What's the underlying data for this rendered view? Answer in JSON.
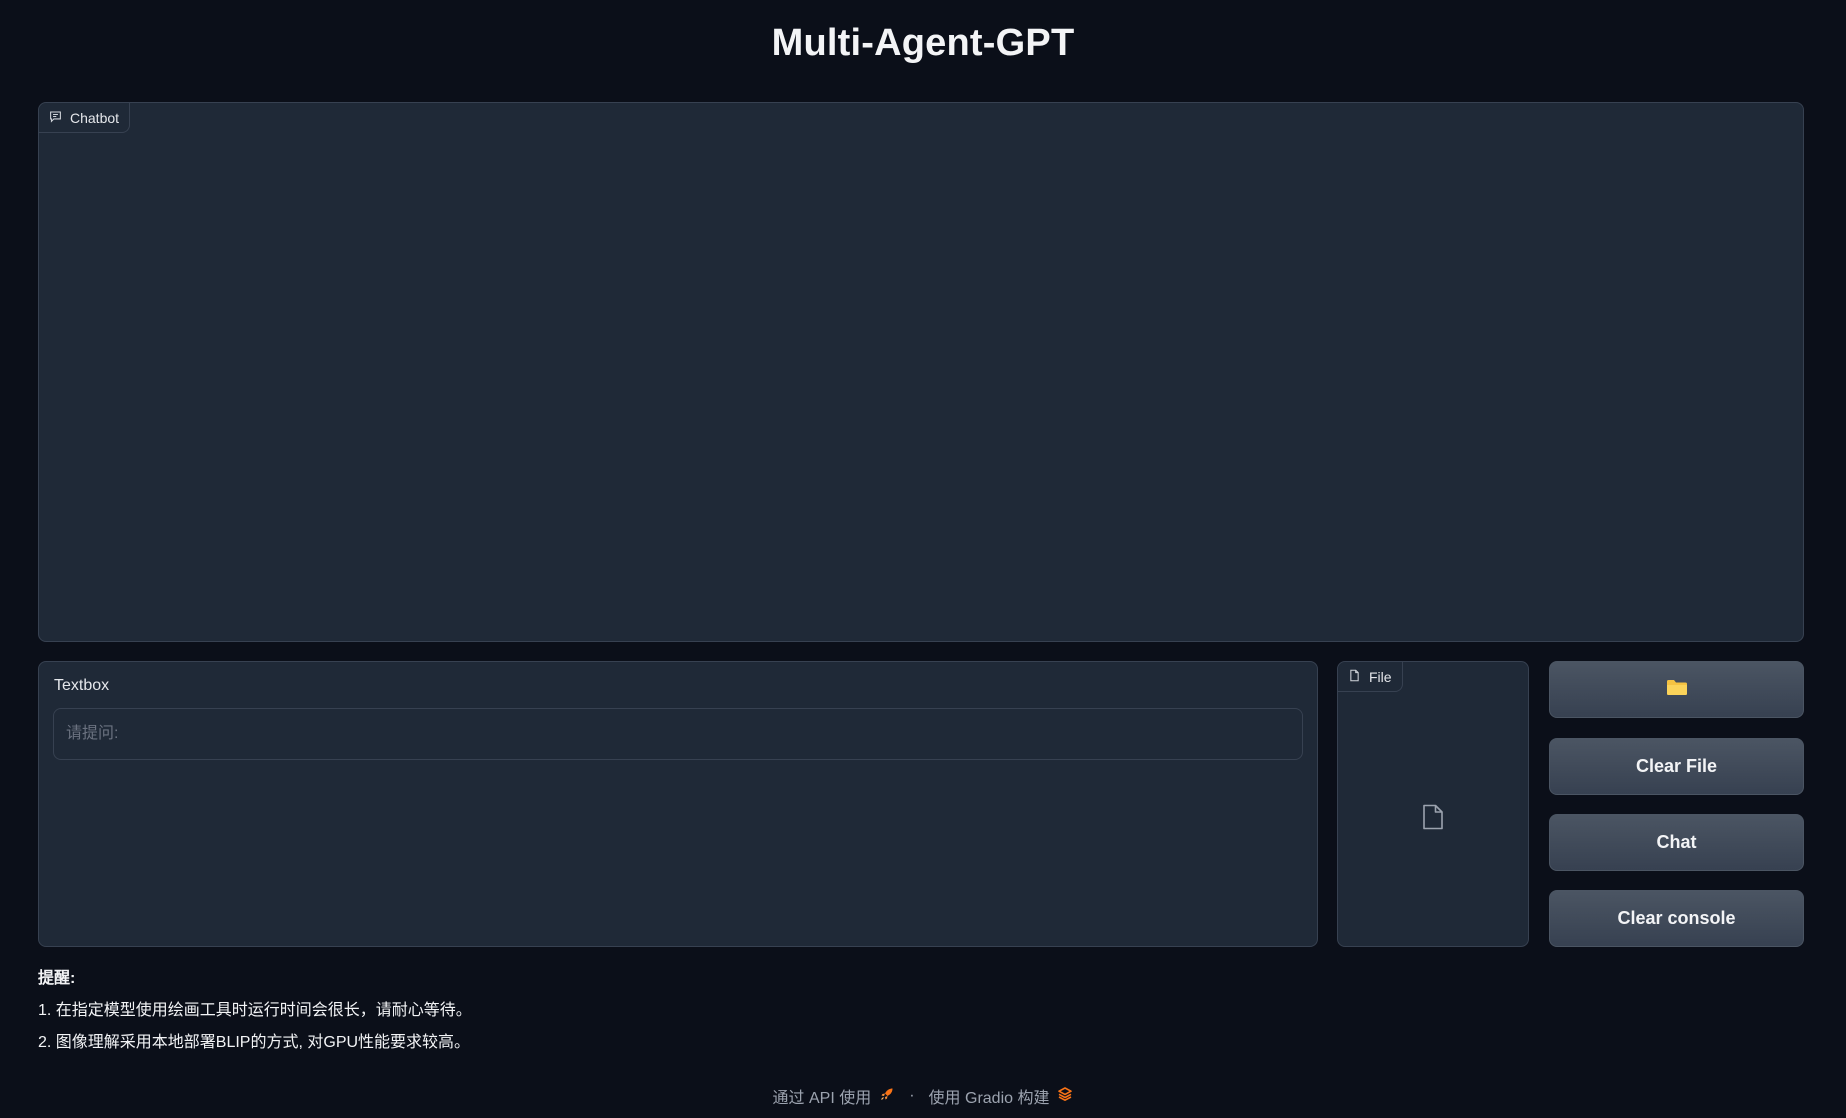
{
  "app": {
    "title": "Multi-Agent-GPT"
  },
  "chatbot": {
    "label": "Chatbot"
  },
  "textbox": {
    "label": "Textbox",
    "value": "",
    "placeholder": "请提问:"
  },
  "file": {
    "label": "File"
  },
  "buttons": {
    "upload_icon": "folder-icon",
    "clear_file": "Clear File",
    "chat": "Chat",
    "clear_console": "Clear console"
  },
  "notes": {
    "title": "提醒:",
    "items": [
      "1. 在指定模型使用绘画工具时运行时间会很长，请耐心等待。",
      "2. 图像理解采用本地部署BLIP的方式, 对GPU性能要求较高。"
    ]
  },
  "footer": {
    "api_link": "通过 API 使用",
    "separator": "·",
    "built_with": "使用 Gradio 构建"
  },
  "colors": {
    "background": "#0b0f19",
    "panel": "#1f2937",
    "border": "#374151",
    "button": "#4b5563",
    "folder": "#f5c242",
    "accent": "#f97316"
  }
}
